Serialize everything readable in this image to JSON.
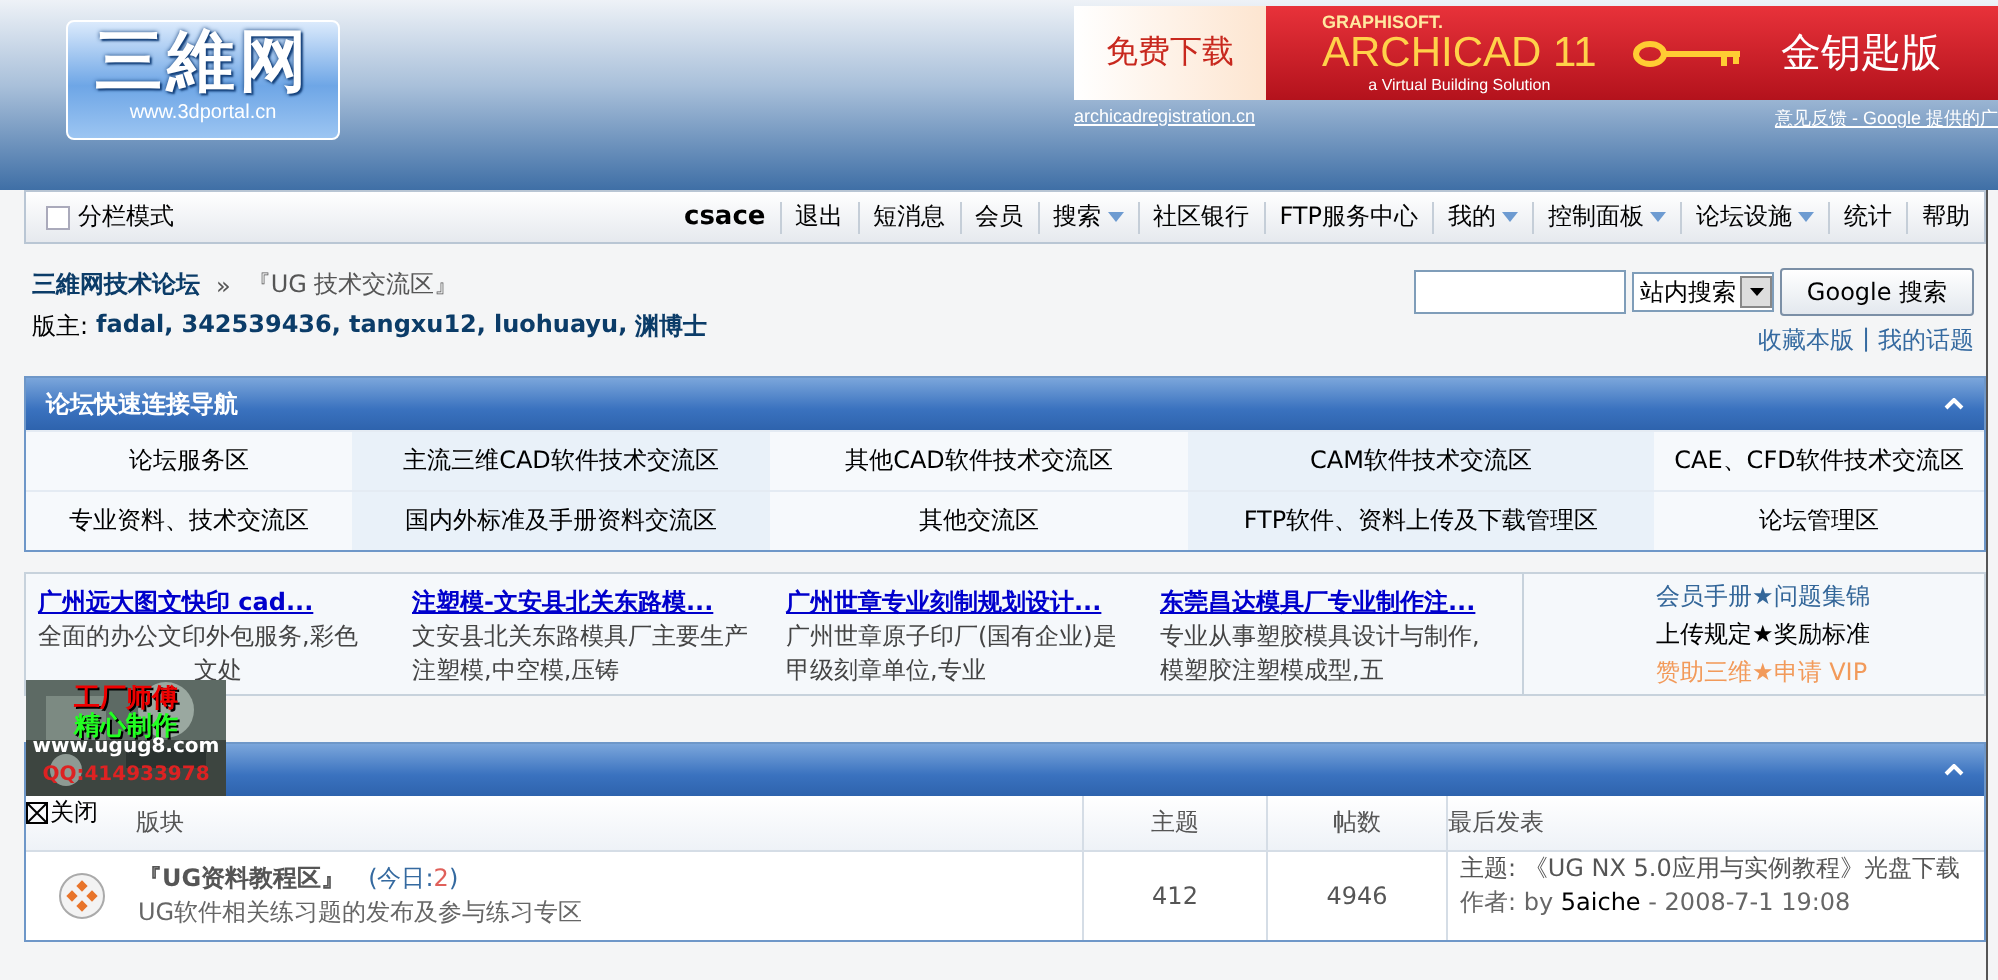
{
  "header": {
    "logo": {
      "title": "三維网",
      "url": "www.3dportal.cn"
    },
    "banner": {
      "cta": "免费下载",
      "brand": "GRAPHISOFT.",
      "product": "ARCHICAD 11",
      "tagline": "a Virtual Building Solution",
      "edition": "金钥匙版"
    },
    "banner_links": [
      "archicadregistration.cn",
      "意见反馈 - Google 提供的广"
    ]
  },
  "toolbar": {
    "column_mode": {
      "label": "分栏模式",
      "checked": false
    },
    "items": [
      {
        "label": "csace",
        "kind": "user",
        "dropdown": false
      },
      {
        "label": "退出",
        "kind": "link",
        "dropdown": false
      },
      {
        "label": "短消息",
        "kind": "link",
        "dropdown": false
      },
      {
        "label": "会员",
        "kind": "link",
        "dropdown": false
      },
      {
        "label": "搜索",
        "kind": "link",
        "dropdown": true
      },
      {
        "label": "社区银行",
        "kind": "link",
        "dropdown": false
      },
      {
        "label": "FTP服务中心",
        "kind": "link",
        "dropdown": false
      },
      {
        "label": "我的",
        "kind": "link",
        "dropdown": true
      },
      {
        "label": "控制面板",
        "kind": "link",
        "dropdown": true
      },
      {
        "label": "论坛设施",
        "kind": "link",
        "dropdown": true
      },
      {
        "label": "统计",
        "kind": "link",
        "dropdown": false
      },
      {
        "label": "帮助",
        "kind": "link",
        "dropdown": false
      }
    ]
  },
  "breadcrumb": {
    "home": "三維网技术论坛",
    "separator": "»",
    "current": "『UG 技术交流区』"
  },
  "moderators": {
    "label": "版主:",
    "separator": ",",
    "names": [
      "fadal",
      "342539436",
      "tangxu12",
      "luohuayu",
      "渊博士"
    ]
  },
  "search": {
    "scope": "站内搜索",
    "button": "Google 搜索",
    "links": [
      "收藏本版",
      "我的话题"
    ],
    "separator": "|"
  },
  "quick_nav": {
    "title": "论坛快速连接导航",
    "expanded": true,
    "items": [
      "论坛服务区",
      "主流三维CAD软件技术交流区",
      "其他CAD软件技术交流区",
      "CAM软件技术交流区",
      "CAE、CFD软件技术交流区",
      "专业资料、技术交流区",
      "国内外标准及手册资料交流区",
      "其他交流区",
      "FTP软件、资料上传及下载管理区",
      "论坛管理区"
    ]
  },
  "ads": [
    {
      "title": "广州远大图文快印 cad...",
      "lines": [
        {
          "text": "全面的办公文印外包服务,彩色",
          "covered": false
        },
        {
          "text": "文处",
          "covered": true
        }
      ]
    },
    {
      "title": "注塑模-文安县北关东路模...",
      "lines": [
        {
          "text": "文安县北关东路模具厂主要生产",
          "covered": false
        },
        {
          "text": "注塑模,中空模,压铸",
          "covered": false
        }
      ]
    },
    {
      "title": "广州世章专业刻制规划设计...",
      "lines": [
        {
          "text": "广州世章原子印厂(国有企业)是",
          "covered": false
        },
        {
          "text": "甲级刻章单位,专业",
          "covered": false
        }
      ]
    },
    {
      "title": "东莞昌达模具厂专业制作注...",
      "lines": [
        {
          "text": "专业从事塑胶模具设计与制作,",
          "covered": false
        },
        {
          "text": "模塑胶注塑模成型,五",
          "covered": false
        }
      ]
    }
  ],
  "notices": [
    {
      "text": "会员手册★问题集锦",
      "color": "#336699"
    },
    {
      "text": "上传规定★奖励标准",
      "color": "#000000"
    },
    {
      "text": "赞助三维★申请 VIP",
      "color": "#f29a5a"
    }
  ],
  "floating_ad": {
    "lines": [
      "工厂师傅",
      "精心制作",
      "www.ugug8.com",
      "QQ:414933978"
    ],
    "close": "关闭"
  },
  "forum_table": {
    "expanded": true,
    "columns": [
      "版块",
      "主题",
      "帖数",
      "最后发表"
    ],
    "rows": [
      {
        "name": "『UG资料教程区』",
        "today_label": "(今日:",
        "today": "2",
        "today_end": ")",
        "description": "UG软件相关练习题的发布及参与练习专区",
        "topics": "412",
        "posts": "4946",
        "last_topic": "主题: 《UG NX 5.0应用与实例教程》光盘下载",
        "last_author_label": "作者: by",
        "last_author": "5aiche",
        "last_time": "- 2008-7-1 19:08"
      }
    ]
  }
}
